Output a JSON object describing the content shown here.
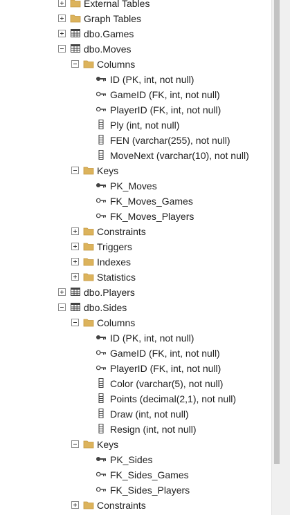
{
  "tree": {
    "items": [
      {
        "label": "External Tables",
        "level": 1,
        "icon": "folder",
        "expander": "plus"
      },
      {
        "label": "Graph Tables",
        "level": 1,
        "icon": "folder",
        "expander": "plus"
      },
      {
        "label": "dbo.Games",
        "level": 1,
        "icon": "table",
        "expander": "plus"
      },
      {
        "label": "dbo.Moves",
        "level": 1,
        "icon": "table",
        "expander": "minus"
      },
      {
        "label": "Columns",
        "level": 2,
        "icon": "folder",
        "expander": "minus"
      },
      {
        "label": "ID (PK, int, not null)",
        "level": 3,
        "icon": "primary-key",
        "expander": "none"
      },
      {
        "label": "GameID (FK, int, not null)",
        "level": 3,
        "icon": "foreign-key",
        "expander": "none"
      },
      {
        "label": "PlayerID (FK, int, not null)",
        "level": 3,
        "icon": "foreign-key",
        "expander": "none"
      },
      {
        "label": "Ply (int, not null)",
        "level": 3,
        "icon": "column",
        "expander": "none"
      },
      {
        "label": "FEN (varchar(255), not null)",
        "level": 3,
        "icon": "column",
        "expander": "none"
      },
      {
        "label": "MoveNext (varchar(10), not null)",
        "level": 3,
        "icon": "column",
        "expander": "none"
      },
      {
        "label": "Keys",
        "level": 2,
        "icon": "folder",
        "expander": "minus"
      },
      {
        "label": "PK_Moves",
        "level": 3,
        "icon": "primary-key",
        "expander": "none"
      },
      {
        "label": "FK_Moves_Games",
        "level": 3,
        "icon": "foreign-key",
        "expander": "none"
      },
      {
        "label": "FK_Moves_Players",
        "level": 3,
        "icon": "foreign-key",
        "expander": "none"
      },
      {
        "label": "Constraints",
        "level": 2,
        "icon": "folder",
        "expander": "plus"
      },
      {
        "label": "Triggers",
        "level": 2,
        "icon": "folder",
        "expander": "plus"
      },
      {
        "label": "Indexes",
        "level": 2,
        "icon": "folder",
        "expander": "plus"
      },
      {
        "label": "Statistics",
        "level": 2,
        "icon": "folder",
        "expander": "plus"
      },
      {
        "label": "dbo.Players",
        "level": 1,
        "icon": "table",
        "expander": "plus"
      },
      {
        "label": "dbo.Sides",
        "level": 1,
        "icon": "table",
        "expander": "minus"
      },
      {
        "label": "Columns",
        "level": 2,
        "icon": "folder",
        "expander": "minus"
      },
      {
        "label": "ID (PK, int, not null)",
        "level": 3,
        "icon": "primary-key",
        "expander": "none"
      },
      {
        "label": "GameID (FK, int, not null)",
        "level": 3,
        "icon": "foreign-key",
        "expander": "none"
      },
      {
        "label": "PlayerID (FK, int, not null)",
        "level": 3,
        "icon": "foreign-key",
        "expander": "none"
      },
      {
        "label": "Color (varchar(5), not null)",
        "level": 3,
        "icon": "column",
        "expander": "none"
      },
      {
        "label": "Points (decimal(2,1), not null)",
        "level": 3,
        "icon": "column",
        "expander": "none"
      },
      {
        "label": "Draw (int, not null)",
        "level": 3,
        "icon": "column",
        "expander": "none"
      },
      {
        "label": "Resign (int, not null)",
        "level": 3,
        "icon": "column",
        "expander": "none"
      },
      {
        "label": "Keys",
        "level": 2,
        "icon": "folder",
        "expander": "minus"
      },
      {
        "label": "PK_Sides",
        "level": 3,
        "icon": "primary-key",
        "expander": "none"
      },
      {
        "label": "FK_Sides_Games",
        "level": 3,
        "icon": "foreign-key",
        "expander": "none"
      },
      {
        "label": "FK_Sides_Players",
        "level": 3,
        "icon": "foreign-key",
        "expander": "none"
      },
      {
        "label": "Constraints",
        "level": 2,
        "icon": "folder",
        "expander": "plus"
      }
    ]
  },
  "colors": {
    "folder": "#dcb35c",
    "folder_dark": "#c4973e",
    "icon_gray": "#424242",
    "text": "#1e1e1e"
  },
  "scrollbar": {
    "position": 0.0,
    "visible_fraction": 0.9
  }
}
